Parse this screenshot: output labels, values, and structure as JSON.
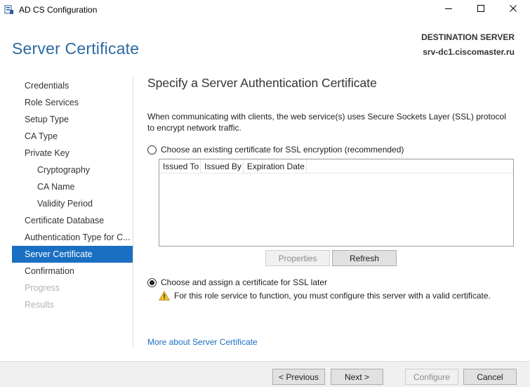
{
  "window": {
    "title": "AD CS Configuration",
    "app_icon": "server-manager-icon",
    "controls": [
      "minimize-icon",
      "maximize-icon",
      "close-icon"
    ]
  },
  "header": {
    "page_title": "Server Certificate",
    "destination_label": "DESTINATION SERVER",
    "destination_server": "srv-dc1.ciscomaster.ru"
  },
  "nav": {
    "items": [
      {
        "label": "Credentials",
        "state": "normal"
      },
      {
        "label": "Role Services",
        "state": "normal"
      },
      {
        "label": "Setup Type",
        "state": "normal"
      },
      {
        "label": "CA Type",
        "state": "normal"
      },
      {
        "label": "Private Key",
        "state": "normal"
      },
      {
        "label": "Cryptography",
        "state": "sub"
      },
      {
        "label": "CA Name",
        "state": "sub"
      },
      {
        "label": "Validity Period",
        "state": "sub"
      },
      {
        "label": "Certificate Database",
        "state": "normal"
      },
      {
        "label": "Authentication Type for C...",
        "state": "normal"
      },
      {
        "label": "Server Certificate",
        "state": "active"
      },
      {
        "label": "Confirmation",
        "state": "normal"
      },
      {
        "label": "Progress",
        "state": "disabled"
      },
      {
        "label": "Results",
        "state": "disabled"
      }
    ]
  },
  "content": {
    "section_title": "Specify a Server Authentication Certificate",
    "description": "When communicating with clients, the web service(s) uses Secure Sockets Layer (SSL) protocol to encrypt network traffic.",
    "option_existing": {
      "label": "Choose an existing certificate for SSL encryption (recommended)",
      "selected": false
    },
    "table": {
      "columns": [
        "Issued To",
        "Issued By",
        "Expiration Date"
      ],
      "rows": []
    },
    "properties_button": "Properties",
    "refresh_button": "Refresh",
    "option_later": {
      "label": "Choose and assign a certificate for SSL later",
      "selected": true
    },
    "warning_icon": "warning-triangle-icon",
    "warning_text": "For this role service to function, you must configure this server with a valid certificate.",
    "more_link": "More about Server Certificate"
  },
  "footer": {
    "previous": "< Previous",
    "next": "Next >",
    "configure": "Configure",
    "cancel": "Cancel"
  },
  "colors": {
    "accent": "#1a6fc2",
    "title_blue": "#2d6a9f",
    "warning_yellow": "#f2c335"
  }
}
